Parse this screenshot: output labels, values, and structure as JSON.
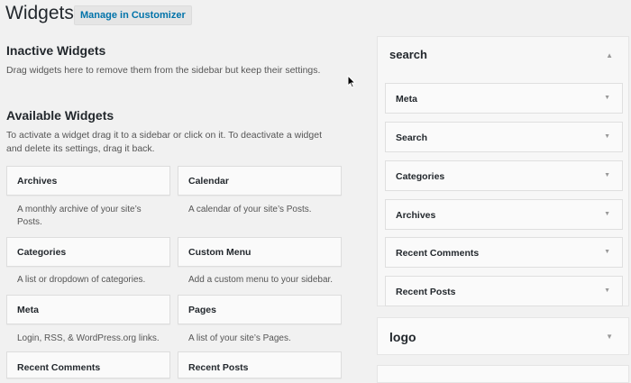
{
  "header": {
    "title": "Widgets",
    "customize_label": "Manage in Customizer"
  },
  "inactive": {
    "title": "Inactive Widgets",
    "description": "Drag widgets here to remove them from the sidebar but keep their settings."
  },
  "available": {
    "title": "Available Widgets",
    "description_line1": "To activate a widget drag it to a sidebar or click on it. To deactivate a widget",
    "description_line2": "and delete its settings, drag it back.",
    "widgets": [
      {
        "title": "Archives",
        "desc_line1": "A monthly archive of your site’s",
        "desc_line2": "Posts."
      },
      {
        "title": "Calendar",
        "desc_line1": "A calendar of your site’s Posts.",
        "desc_line2": ""
      },
      {
        "title": "Categories",
        "desc_line1": "A list or dropdown of categories.",
        "desc_line2": ""
      },
      {
        "title": "Custom Menu",
        "desc_line1": "Add a custom menu to your sidebar.",
        "desc_line2": ""
      },
      {
        "title": "Meta",
        "desc_line1": "Login, RSS, & WordPress.org links.",
        "desc_line2": ""
      },
      {
        "title": "Pages",
        "desc_line1": "A list of your site’s Pages.",
        "desc_line2": ""
      },
      {
        "title": "Recent Comments",
        "desc_line1": "",
        "desc_line2": ""
      },
      {
        "title": "Recent Posts",
        "desc_line1": "",
        "desc_line2": ""
      }
    ]
  },
  "sidebars": [
    {
      "title": "search",
      "widgets": [
        "Meta",
        "Search",
        "Categories",
        "Archives",
        "Recent Comments",
        "Recent Posts"
      ]
    },
    {
      "title": "logo",
      "widgets": []
    }
  ],
  "icons": {
    "expanded_arrow": "arrow-up-icon",
    "collapsed_arrow": "arrow-down-icon",
    "cursor": "mouse-pointer-icon"
  },
  "colors": {
    "link": "#0073aa",
    "background": "#f1f1f1"
  }
}
